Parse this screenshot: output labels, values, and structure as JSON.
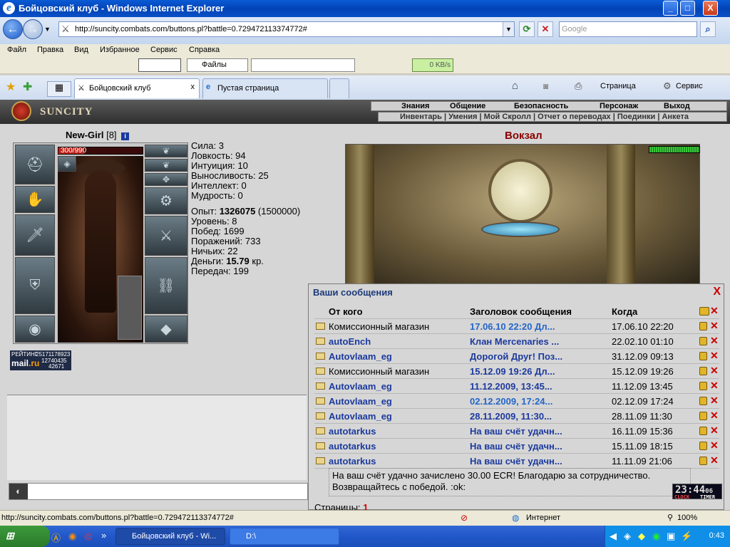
{
  "window": {
    "title": "Бойцовский клуб - Windows Internet Explorer",
    "minimize_label": "_",
    "maximize_label": "□",
    "close_label": "X"
  },
  "nav": {
    "back_label": "←",
    "forward_label": "→",
    "dropdown_label": "▼",
    "url": "http://suncity.combats.com/buttons.pl?battle=0.729472113374772#",
    "refresh_label": "⟳",
    "stop_label": "✕",
    "search_placeholder": "Google",
    "search_button_label": "⌕"
  },
  "menu": {
    "items": [
      "Файл",
      "Правка",
      "Вид",
      "Избранное",
      "Сервис",
      "Справка"
    ]
  },
  "toolbar": {
    "files_label": "Файлы",
    "speed": "0 KB/s"
  },
  "tabs": [
    {
      "label": "Бойцовский клуб",
      "close": "x"
    },
    {
      "label": "Пустая страница"
    }
  ],
  "ie_tools": {
    "page_label": "Страница",
    "service_label": "Сервис"
  },
  "game": {
    "logo": "SUNCITY",
    "top_menu": [
      "Знания",
      "Общение",
      "Безопасность",
      "Персонаж",
      "Выход"
    ],
    "sub_menu": "Инвентарь | Умения | Мой Скролл | Отчет о переводах | Поединки | Анкета",
    "character": {
      "name": "New-Girl",
      "level": "[8]",
      "info": "i",
      "hp": "300/990",
      "hp_fraction": 0.303
    },
    "stats": {
      "str": "Сила: 3",
      "agi": "Ловкость: 94",
      "int": "Интуиция: 10",
      "end": "Выносливость: 25",
      "intel": "Интеллект: 0",
      "wis": "Мудрость: 0",
      "exp_label": "Опыт: ",
      "exp_value": "1326075",
      "exp_next": " (1500000)",
      "level": "Уровень: 8",
      "wins": "Побед: 1699",
      "losses": "Поражений: 733",
      "draws": "Ничьих: 22",
      "money_label": "Деньги: ",
      "money_value": "15.79",
      "money_unit": " кр.",
      "transfers": "Передач: 199"
    },
    "rating": {
      "label": "РЕЙТИНГ",
      "n1": "25171178923",
      "n2": "12740435",
      "n3": "42671",
      "brand_a": "mail",
      "brand_b": ".ru"
    },
    "location": "Вокзал"
  },
  "messages": {
    "title": "Ваши сообщения",
    "close": "X",
    "headers": {
      "from": "От кого",
      "subject": "Заголовок сообщения",
      "when": "Когда"
    },
    "rows": [
      {
        "from": "Комиссионный магазин",
        "subject": "17.06.10 22:20 Дл...",
        "when": "17.06.10 22:20",
        "from_style": "plain",
        "subj_style": "light-blue"
      },
      {
        "from": "autoEnch",
        "subject": "Клан Mercenaries ...",
        "when": "22.02.10 01:10",
        "from_style": "bold-blue",
        "subj_style": "bold-blue"
      },
      {
        "from": "Autovlaam_eg",
        "subject": "Дорогой Друг! Поз...",
        "when": "31.12.09 09:13",
        "from_style": "bold-blue",
        "subj_style": "bold-blue"
      },
      {
        "from": "Комиссионный магазин",
        "subject": "15.12.09 19:26 Дл...",
        "when": "15.12.09 19:26",
        "from_style": "plain",
        "subj_style": "bold-blue"
      },
      {
        "from": "Autovlaam_eg",
        "subject": "11.12.2009, 13:45...",
        "when": "11.12.09 13:45",
        "from_style": "bold-blue",
        "subj_style": "bold-blue"
      },
      {
        "from": "Autovlaam_eg",
        "subject": "02.12.2009, 17:24...",
        "when": "02.12.09 17:24",
        "from_style": "bold-blue",
        "subj_style": "light-blue"
      },
      {
        "from": "Autovlaam_eg",
        "subject": "28.11.2009, 11:30...",
        "when": "28.11.09 11:30",
        "from_style": "bold-blue",
        "subj_style": "bold-blue"
      },
      {
        "from": "autotarkus",
        "subject": "На ваш счёт удачн...",
        "when": "16.11.09 15:36",
        "from_style": "bold-blue",
        "subj_style": "bold-blue"
      },
      {
        "from": "autotarkus",
        "subject": "На ваш счёт удачн...",
        "when": "15.11.09 18:15",
        "from_style": "bold-blue",
        "subj_style": "bold-blue"
      },
      {
        "from": "autotarkus",
        "subject": "На ваш счёт удачн...",
        "when": "11.11.09 21:06",
        "from_style": "bold-blue",
        "subj_style": "bold-blue"
      }
    ],
    "preview": "На ваш счёт удачно зачислено 30.00 ECR! Благодарю за сотрудничество. Возвращайтесь с победой. :ok:",
    "pages_label": "Страницы: ",
    "page_current": "1",
    "clock_time": "23:44",
    "clock_sec": "06",
    "clock_label": "CLOCK",
    "timer_label": "TIMER"
  },
  "status": {
    "url": "http://suncity.combats.com/buttons.pl?battle=0.729472113374772#",
    "zone": "Интернет",
    "zoom": "100%"
  },
  "taskbar": {
    "tasks": [
      "Бойцовский клуб - Wi...",
      "D:\\"
    ],
    "time": "0:43"
  }
}
